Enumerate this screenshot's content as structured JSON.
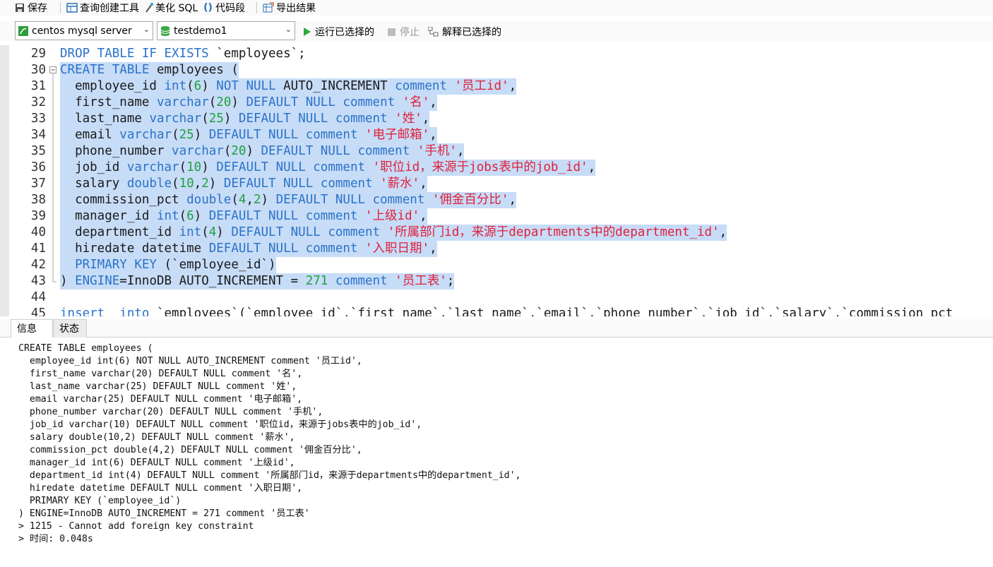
{
  "toolbar": {
    "save": "保存",
    "query_builder": "查询创建工具",
    "beautify": "美化 SQL",
    "snippet": "代码段",
    "export": "导出结果"
  },
  "connection": {
    "server": "centos mysql server",
    "database": "testdemo1",
    "run_selected": "运行已选择的",
    "stop": "停止",
    "explain_selected": "解释已选择的"
  },
  "editor": {
    "lines": [
      {
        "n": "29",
        "sel": false,
        "segs": [
          [
            "kw",
            "DROP TABLE IF EXISTS"
          ],
          [
            "plain",
            " `employees`;"
          ]
        ]
      },
      {
        "n": "30",
        "sel": true,
        "segs": [
          [
            "kw",
            "CREATE TABLE"
          ],
          [
            "plain",
            " employees ("
          ]
        ]
      },
      {
        "n": "31",
        "sel": true,
        "segs": [
          [
            "plain",
            "  employee_id "
          ],
          [
            "kw",
            "int"
          ],
          [
            "plain",
            "("
          ],
          [
            "num",
            "6"
          ],
          [
            "plain",
            ") "
          ],
          [
            "kw",
            "NOT NULL"
          ],
          [
            "plain",
            " AUTO_INCREMENT "
          ],
          [
            "kw",
            "comment"
          ],
          [
            "plain",
            " "
          ],
          [
            "str",
            "'员工id'"
          ],
          [
            "plain",
            ","
          ]
        ]
      },
      {
        "n": "32",
        "sel": true,
        "segs": [
          [
            "plain",
            "  first_name "
          ],
          [
            "kw",
            "varchar"
          ],
          [
            "plain",
            "("
          ],
          [
            "num",
            "20"
          ],
          [
            "plain",
            ") "
          ],
          [
            "kw",
            "DEFAULT NULL comment"
          ],
          [
            "plain",
            " "
          ],
          [
            "str",
            "'名'"
          ],
          [
            "plain",
            ","
          ]
        ]
      },
      {
        "n": "33",
        "sel": true,
        "segs": [
          [
            "plain",
            "  last_name "
          ],
          [
            "kw",
            "varchar"
          ],
          [
            "plain",
            "("
          ],
          [
            "num",
            "25"
          ],
          [
            "plain",
            ") "
          ],
          [
            "kw",
            "DEFAULT NULL comment"
          ],
          [
            "plain",
            " "
          ],
          [
            "str",
            "'姓'"
          ],
          [
            "plain",
            ","
          ]
        ]
      },
      {
        "n": "34",
        "sel": true,
        "segs": [
          [
            "plain",
            "  email "
          ],
          [
            "kw",
            "varchar"
          ],
          [
            "plain",
            "("
          ],
          [
            "num",
            "25"
          ],
          [
            "plain",
            ") "
          ],
          [
            "kw",
            "DEFAULT NULL comment"
          ],
          [
            "plain",
            " "
          ],
          [
            "str",
            "'电子邮箱'"
          ],
          [
            "plain",
            ","
          ]
        ]
      },
      {
        "n": "35",
        "sel": true,
        "segs": [
          [
            "plain",
            "  phone_number "
          ],
          [
            "kw",
            "varchar"
          ],
          [
            "plain",
            "("
          ],
          [
            "num",
            "20"
          ],
          [
            "plain",
            ") "
          ],
          [
            "kw",
            "DEFAULT NULL comment"
          ],
          [
            "plain",
            " "
          ],
          [
            "str",
            "'手机'"
          ],
          [
            "plain",
            ","
          ]
        ]
      },
      {
        "n": "36",
        "sel": true,
        "segs": [
          [
            "plain",
            "  job_id "
          ],
          [
            "kw",
            "varchar"
          ],
          [
            "plain",
            "("
          ],
          [
            "num",
            "10"
          ],
          [
            "plain",
            ") "
          ],
          [
            "kw",
            "DEFAULT NULL comment"
          ],
          [
            "plain",
            " "
          ],
          [
            "str",
            "'职位id，来源于jobs表中的job_id'"
          ],
          [
            "plain",
            ","
          ]
        ]
      },
      {
        "n": "37",
        "sel": true,
        "segs": [
          [
            "plain",
            "  salary "
          ],
          [
            "kw",
            "double"
          ],
          [
            "plain",
            "("
          ],
          [
            "num",
            "10"
          ],
          [
            "plain",
            ","
          ],
          [
            "num",
            "2"
          ],
          [
            "plain",
            ") "
          ],
          [
            "kw",
            "DEFAULT NULL comment"
          ],
          [
            "plain",
            " "
          ],
          [
            "str",
            "'薪水'"
          ],
          [
            "plain",
            ","
          ]
        ]
      },
      {
        "n": "38",
        "sel": true,
        "segs": [
          [
            "plain",
            "  commission_pct "
          ],
          [
            "kw",
            "double"
          ],
          [
            "plain",
            "("
          ],
          [
            "num",
            "4"
          ],
          [
            "plain",
            ","
          ],
          [
            "num",
            "2"
          ],
          [
            "plain",
            ") "
          ],
          [
            "kw",
            "DEFAULT NULL comment"
          ],
          [
            "plain",
            " "
          ],
          [
            "str",
            "'佣金百分比'"
          ],
          [
            "plain",
            ","
          ]
        ]
      },
      {
        "n": "39",
        "sel": true,
        "segs": [
          [
            "plain",
            "  manager_id "
          ],
          [
            "kw",
            "int"
          ],
          [
            "plain",
            "("
          ],
          [
            "num",
            "6"
          ],
          [
            "plain",
            ") "
          ],
          [
            "kw",
            "DEFAULT NULL comment"
          ],
          [
            "plain",
            " "
          ],
          [
            "str",
            "'上级id'"
          ],
          [
            "plain",
            ","
          ]
        ]
      },
      {
        "n": "40",
        "sel": true,
        "segs": [
          [
            "plain",
            "  department_id "
          ],
          [
            "kw",
            "int"
          ],
          [
            "plain",
            "("
          ],
          [
            "num",
            "4"
          ],
          [
            "plain",
            ") "
          ],
          [
            "kw",
            "DEFAULT NULL comment"
          ],
          [
            "plain",
            " "
          ],
          [
            "str",
            "'所属部门id，来源于departments中的department_id'"
          ],
          [
            "plain",
            ","
          ]
        ]
      },
      {
        "n": "41",
        "sel": true,
        "segs": [
          [
            "plain",
            "  hiredate datetime "
          ],
          [
            "kw",
            "DEFAULT NULL comment"
          ],
          [
            "plain",
            " "
          ],
          [
            "str",
            "'入职日期'"
          ],
          [
            "plain",
            ","
          ]
        ]
      },
      {
        "n": "42",
        "sel": true,
        "segs": [
          [
            "plain",
            "  "
          ],
          [
            "kw",
            "PRIMARY KEY"
          ],
          [
            "plain",
            " (`employee_id`)"
          ]
        ]
      },
      {
        "n": "43",
        "sel": true,
        "segs": [
          [
            "plain",
            ") "
          ],
          [
            "kw",
            "ENGINE"
          ],
          [
            "plain",
            "=InnoDB AUTO_INCREMENT = "
          ],
          [
            "num",
            "271"
          ],
          [
            "plain",
            " "
          ],
          [
            "kw",
            "comment"
          ],
          [
            "plain",
            " "
          ],
          [
            "str",
            "'员工表'"
          ],
          [
            "plain",
            ";"
          ]
        ]
      },
      {
        "n": "44",
        "sel": false,
        "segs": []
      },
      {
        "n": "45",
        "sel": false,
        "segs": [
          [
            "kw",
            "insert  into"
          ],
          [
            "plain",
            " `employees`(`employee_id`,`first_name`,`last_name`,`email`,`phone_number`,`job_id`,`salary`,`commission_pct"
          ]
        ]
      }
    ]
  },
  "tabs": {
    "info": "信息",
    "status": "状态"
  },
  "output": {
    "lines": [
      "CREATE TABLE employees (",
      "  employee_id int(6) NOT NULL AUTO_INCREMENT comment '员工id',",
      "  first_name varchar(20) DEFAULT NULL comment '名',",
      "  last_name varchar(25) DEFAULT NULL comment '姓',",
      "  email varchar(25) DEFAULT NULL comment '电子邮箱',",
      "  phone_number varchar(20) DEFAULT NULL comment '手机',",
      "  job_id varchar(10) DEFAULT NULL comment '职位id，来源于jobs表中的job_id',",
      "  salary double(10,2) DEFAULT NULL comment '薪水',",
      "  commission_pct double(4,2) DEFAULT NULL comment '佣金百分比',",
      "  manager_id int(6) DEFAULT NULL comment '上级id',",
      "  department_id int(4) DEFAULT NULL comment '所属部门id，来源于departments中的department_id',",
      "  hiredate datetime DEFAULT NULL comment '入职日期',",
      "  PRIMARY KEY (`employee_id`)",
      ") ENGINE=InnoDB AUTO_INCREMENT = 271 comment '员工表'",
      "> 1215 - Cannot add foreign key constraint",
      "> 时间: 0.048s"
    ]
  }
}
